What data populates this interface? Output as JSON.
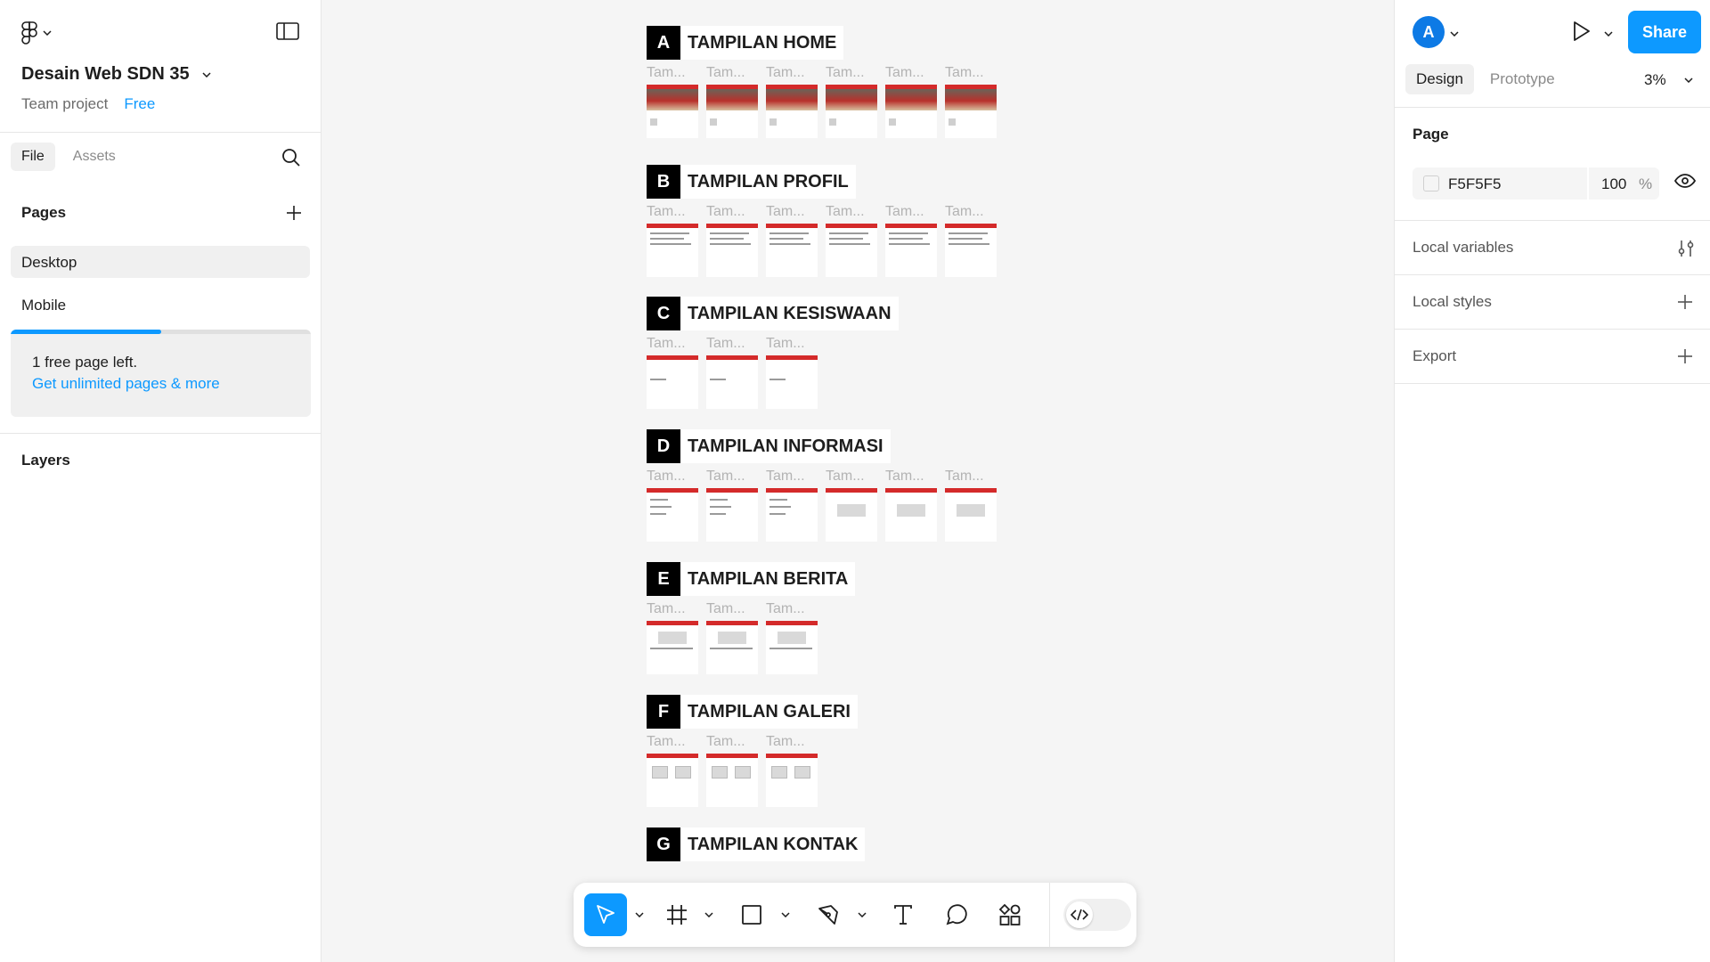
{
  "app": {
    "file_name": "Desain Web SDN 35",
    "team": "Team project",
    "plan": "Free"
  },
  "left_panel": {
    "tabs": [
      "File",
      "Assets"
    ],
    "pages_title": "Pages",
    "pages": [
      "Desktop",
      "Mobile"
    ],
    "quota": {
      "message": "1 free page left.",
      "link": "Get unlimited pages & more",
      "progress": 0.5
    },
    "layers_title": "Layers"
  },
  "right_panel": {
    "avatar_initial": "A",
    "share_label": "Share",
    "tabs": [
      "Design",
      "Prototype"
    ],
    "zoom": "3%",
    "page_title": "Page",
    "page_color": "F5F5F5",
    "page_opacity": "100",
    "page_opacity_unit": "%",
    "local_variables": "Local variables",
    "local_styles": "Local styles",
    "export": "Export"
  },
  "canvas": {
    "background": "#F5F5F5",
    "sections": [
      {
        "letter": "A",
        "title": "TAMPILAN HOME",
        "thumb_labels": [
          "Tam...",
          "Tam...",
          "Tam...",
          "Tam...",
          "Tam...",
          "Tam..."
        ]
      },
      {
        "letter": "B",
        "title": "TAMPILAN PROFIL",
        "thumb_labels": [
          "Tam...",
          "Tam...",
          "Tam...",
          "Tam...",
          "Tam...",
          "Tam..."
        ]
      },
      {
        "letter": "C",
        "title": "TAMPILAN KESISWAAN",
        "thumb_labels": [
          "Tam...",
          "Tam...",
          "Tam..."
        ]
      },
      {
        "letter": "D",
        "title": "TAMPILAN INFORMASI",
        "thumb_labels": [
          "Tam...",
          "Tam...",
          "Tam...",
          "Tam...",
          "Tam...",
          "Tam..."
        ]
      },
      {
        "letter": "E",
        "title": "TAMPILAN BERITA",
        "thumb_labels": [
          "Tam...",
          "Tam...",
          "Tam..."
        ]
      },
      {
        "letter": "F",
        "title": "TAMPILAN GALERI",
        "thumb_labels": [
          "Tam...",
          "Tam...",
          "Tam..."
        ]
      },
      {
        "letter": "G",
        "title": "TAMPILAN KONTAK",
        "thumb_labels": []
      }
    ]
  },
  "toolbar": {
    "tools": [
      "move-tool",
      "frame-tool",
      "rectangle-tool",
      "pen-tool",
      "text-tool",
      "comment-tool",
      "actions-tool",
      "dev-mode-toggle"
    ]
  },
  "help_label": "?",
  "colors": {
    "accent": "#0D99FF",
    "section_label_bg": "#000000"
  }
}
